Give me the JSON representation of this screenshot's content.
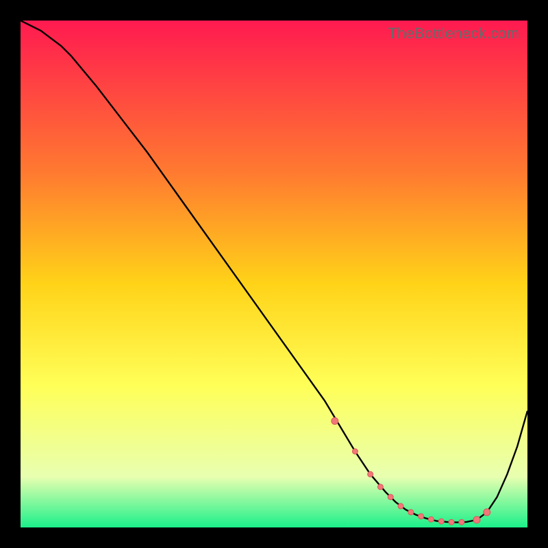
{
  "watermark": "TheBottleneck.com",
  "colors": {
    "gradient_top": "#ff1a50",
    "gradient_mid1": "#ff7a30",
    "gradient_mid2": "#ffd318",
    "gradient_mid3": "#ffff58",
    "gradient_mid4": "#e8ffb0",
    "gradient_bottom": "#1bf08a",
    "curve": "#000000",
    "marker_fill": "#f07878",
    "marker_stroke": "#d85a5a"
  },
  "chart_data": {
    "type": "line",
    "title": "",
    "xlabel": "",
    "ylabel": "",
    "xlim": [
      0,
      100
    ],
    "ylim": [
      0,
      100
    ],
    "series": [
      {
        "name": "curve",
        "x": [
          0,
          4,
          8,
          10,
          15,
          20,
          25,
          30,
          35,
          40,
          45,
          50,
          55,
          60,
          63,
          66,
          69,
          72,
          74,
          76,
          78,
          80,
          82,
          84,
          86,
          88,
          90,
          92,
          94,
          96,
          98,
          100
        ],
        "y": [
          100,
          98,
          95,
          93,
          87,
          80.5,
          74,
          67,
          60,
          53,
          46,
          39,
          32,
          25,
          20,
          15,
          10.5,
          7,
          5,
          3.5,
          2.5,
          1.8,
          1.3,
          1.1,
          1.0,
          1.1,
          1.5,
          3.0,
          6.0,
          10.5,
          16,
          23
        ]
      }
    ],
    "markers": {
      "x": [
        62,
        66,
        69,
        71,
        73,
        75,
        77,
        79,
        81,
        83,
        85,
        87,
        90,
        92
      ],
      "y": [
        21,
        15,
        10.5,
        8,
        6,
        4.2,
        3.0,
        2.2,
        1.6,
        1.2,
        1.05,
        1.05,
        1.5,
        3.0
      ],
      "r": [
        5,
        4,
        4,
        4,
        4,
        4,
        4,
        4,
        4,
        4,
        4,
        4,
        5,
        5
      ]
    }
  }
}
